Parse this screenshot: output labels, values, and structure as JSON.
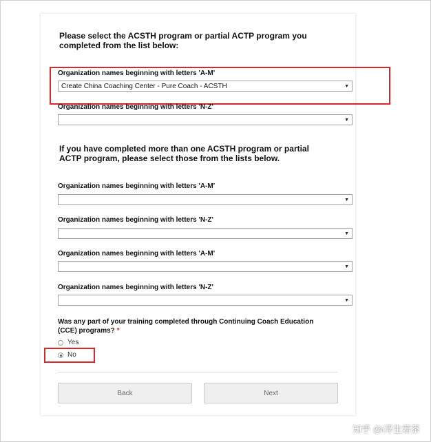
{
  "intro": {
    "line1": "Please select the ACSTH program or partial ACTP program you",
    "line2": "completed from the list below:"
  },
  "primary": {
    "am_label": "Organization names beginning with letters 'A-M'",
    "am_value": "Create China Coaching Center - Pure Coach - ACSTH",
    "nz_label": "Organization names beginning with letters 'N-Z'",
    "nz_value": ""
  },
  "additional": {
    "line1": "If you have completed more than one ACSTH program or partial",
    "line2": "ACTP program, please select those from the lists below.",
    "dropdowns": [
      {
        "label": "Organization names beginning with letters 'A-M'",
        "value": ""
      },
      {
        "label": "Organization names beginning with letters 'N-Z'",
        "value": ""
      },
      {
        "label": "Organization names beginning with letters 'A-M'",
        "value": ""
      },
      {
        "label": "Organization names beginning with letters 'N-Z'",
        "value": ""
      }
    ]
  },
  "cce": {
    "question_line1": "Was any part of your training completed through Continuing Coach Education",
    "question_line2": "(CCE) programs?",
    "required_mark": "*",
    "options": [
      {
        "label": "Yes",
        "checked": false
      },
      {
        "label": "No",
        "checked": true
      }
    ]
  },
  "buttons": {
    "back": "Back",
    "next": "Next"
  },
  "icons": {
    "dropdown": "▼"
  },
  "watermark": "知乎 @i浮生若茶",
  "colors": {
    "highlight": "#d9262b"
  }
}
